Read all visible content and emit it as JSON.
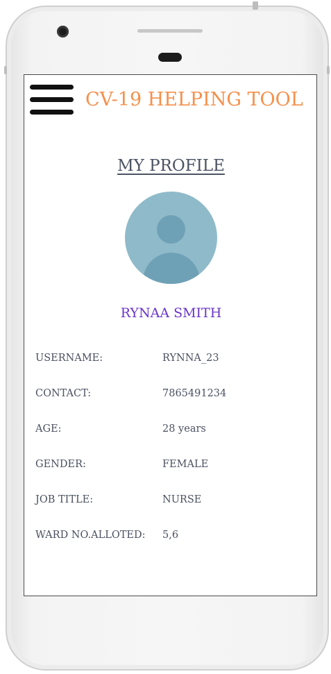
{
  "header": {
    "app_title": "CV-19 HELPING TOOL"
  },
  "profile": {
    "page_title": "MY PROFILE",
    "name": "RYNAA SMITH",
    "fields": [
      {
        "label": "USERNAME:",
        "value": "RYNNA_23"
      },
      {
        "label": "CONTACT:",
        "value": "7865491234"
      },
      {
        "label": "AGE:",
        "value": "28 years"
      },
      {
        "label": "GENDER:",
        "value": "FEMALE"
      },
      {
        "label": "JOB TITLE:",
        "value": "NURSE"
      },
      {
        "label": "WARD NO.ALLOTED:",
        "value": "5,6"
      }
    ]
  },
  "icons": {
    "menu": "hamburger-menu-icon",
    "avatar": "user-avatar-icon"
  },
  "colors": {
    "app_title": "#f5904b",
    "user_name": "#6b35c9",
    "text": "#4a5160",
    "avatar_bg": "#8fbac9",
    "avatar_fg": "#6fa1b6"
  }
}
